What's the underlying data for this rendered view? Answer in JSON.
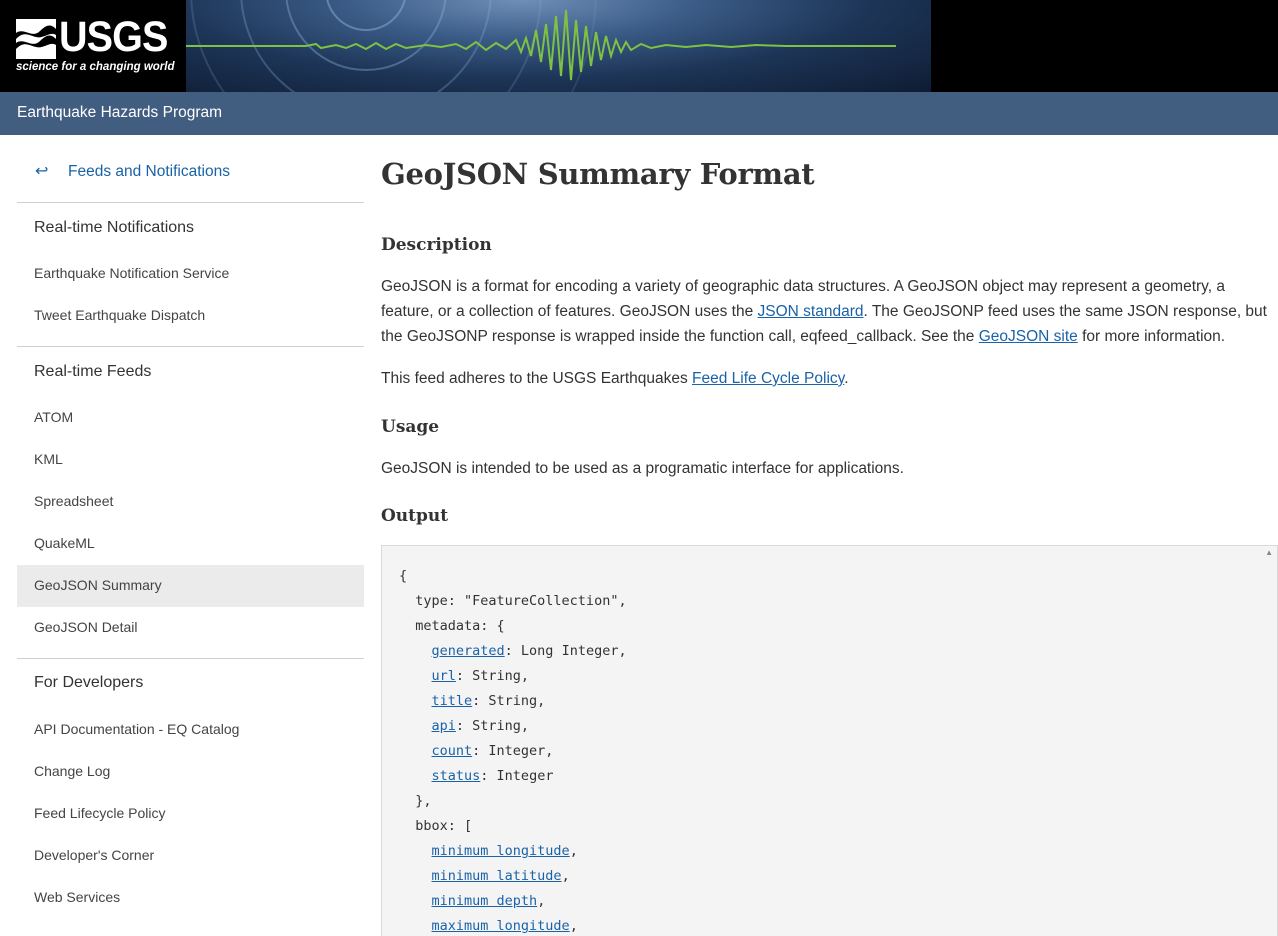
{
  "header": {
    "logo_text": "USGS",
    "logo_tagline": "science for a changing world",
    "program_title": "Earthquake Hazards Program"
  },
  "sidebar": {
    "back_label": "Feeds and Notifications",
    "back_icon": "return-arrow-icon",
    "sections": [
      {
        "title": "Real-time Notifications",
        "items": [
          "Earthquake Notification Service",
          "Tweet Earthquake Dispatch"
        ]
      },
      {
        "title": "Real-time Feeds",
        "items": [
          "ATOM",
          "KML",
          "Spreadsheet",
          "QuakeML",
          "GeoJSON Summary",
          "GeoJSON Detail"
        ]
      },
      {
        "title": "For Developers",
        "items": [
          "API Documentation - EQ Catalog",
          "Change Log",
          "Feed Lifecycle Policy",
          "Developer's Corner",
          "Web Services"
        ]
      }
    ],
    "active_item": "GeoJSON Summary"
  },
  "main": {
    "title": "GeoJSON Summary Format",
    "description_heading": "Description",
    "description": {
      "part1": "GeoJSON is a format for encoding a variety of geographic data structures. A GeoJSON object may represent a geometry, a feature, or a collection of features. GeoJSON uses the ",
      "link1": "JSON standard",
      "part2": ". The GeoJSONP feed uses the same JSON response, but the GeoJSONP response is wrapped inside the function call, eqfeed_callback. See the ",
      "link2": "GeoJSON site",
      "part3": " for more information."
    },
    "policy": {
      "text": "This feed adheres to the USGS Earthquakes ",
      "link": "Feed Life Cycle Policy",
      "end": "."
    },
    "usage_heading": "Usage",
    "usage_text": "GeoJSON is intended to be used as a programatic interface for applications.",
    "output_heading": "Output",
    "code": {
      "open": "{",
      "type_line": "  type: \"FeatureCollection\",",
      "metadata_open": "  metadata: {",
      "metadata_fields": [
        {
          "name": "generated",
          "value": ": Long Integer,"
        },
        {
          "name": "url",
          "value": ": String,"
        },
        {
          "name": "title",
          "value": ": String,"
        },
        {
          "name": "api",
          "value": ": String,"
        },
        {
          "name": "count",
          "value": ": Integer,"
        },
        {
          "name": "status",
          "value": ": Integer"
        }
      ],
      "metadata_close": "  },",
      "bbox_open": "  bbox: [",
      "bbox_fields": [
        {
          "name": "minimum longitude",
          "value": ","
        },
        {
          "name": "minimum latitude",
          "value": ","
        },
        {
          "name": "minimum depth",
          "value": ","
        },
        {
          "name": "maximum longitude",
          "value": ","
        }
      ]
    }
  },
  "colors": {
    "header_bg": "#000000",
    "program_bar": "#415e81",
    "link": "#1a62a8",
    "active_nav_bg": "#ebebeb",
    "code_bg": "#f4f4f4",
    "seismogram": "#7dc242"
  }
}
